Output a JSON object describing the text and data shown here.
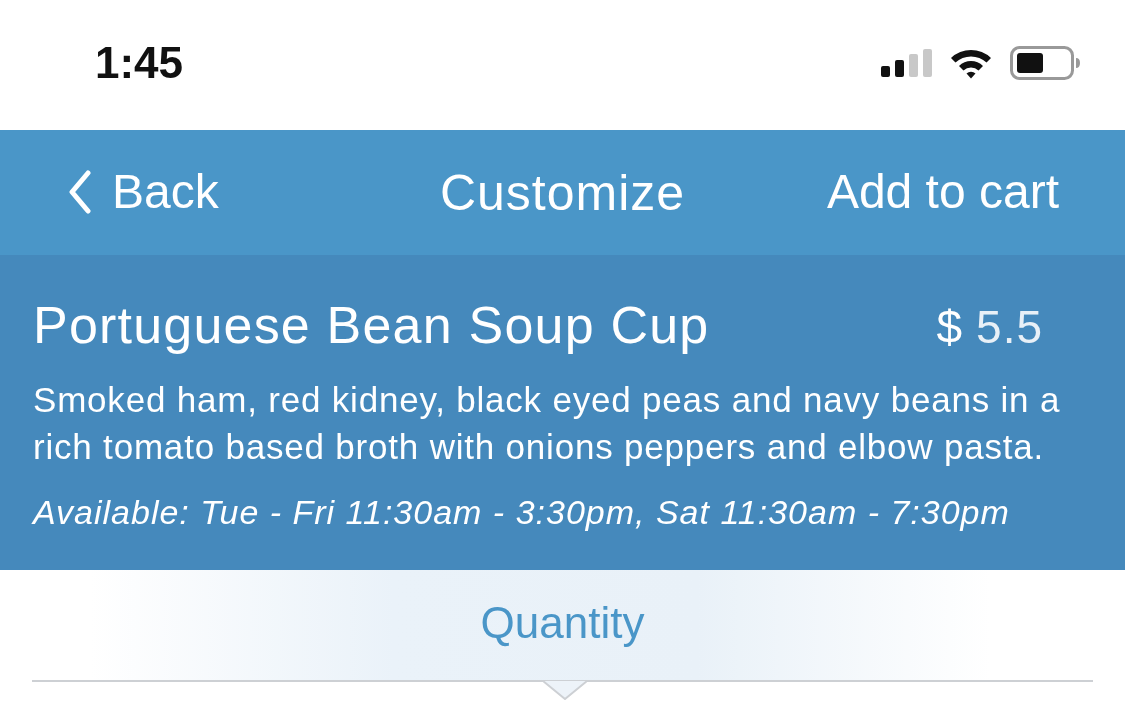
{
  "status_bar": {
    "time": "1:45"
  },
  "nav_bar": {
    "back_label": "Back",
    "title": "Customize",
    "action_label": "Add to cart"
  },
  "item": {
    "name": "Portuguese Bean Soup Cup",
    "price_currency": "$",
    "price_amount": "5.5",
    "description": "Smoked ham, red kidney, black eyed peas and navy beans in a rich tomato based broth with onions peppers and elbow pasta.",
    "availability": "Available: Tue - Fri 11:30am - 3:30pm, Sat 11:30am - 7:30pm"
  },
  "section": {
    "title": "Quantity"
  }
}
